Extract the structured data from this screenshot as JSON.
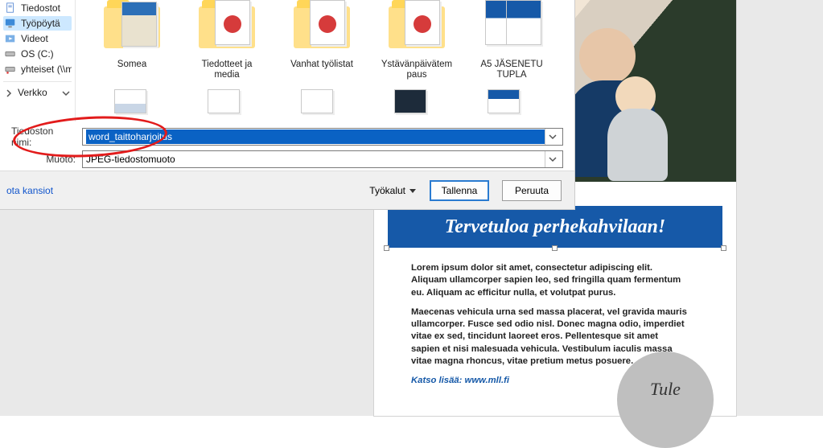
{
  "sidebar": {
    "items": [
      {
        "label": "Tiedostot",
        "icon": "document-icon"
      },
      {
        "label": "Työpöytä",
        "icon": "desktop-icon"
      },
      {
        "label": "Videot",
        "icon": "video-icon"
      },
      {
        "label": "OS (C:)",
        "icon": "drive-icon"
      },
      {
        "label": "yhteiset (\\\\mlltku",
        "icon": "network-drive-icon"
      }
    ],
    "network_label": "Verkko"
  },
  "files": {
    "row1": [
      {
        "label": "Somea",
        "kind": "folder"
      },
      {
        "label": "Tiedotteet ja media",
        "kind": "folder-pdf"
      },
      {
        "label": "Vanhat työlistat",
        "kind": "folder-pdf"
      },
      {
        "label": "Ystävänpäivätem paus",
        "kind": "folder-pdf"
      },
      {
        "label": "A5 JÄSENETU TUPLA",
        "kind": "doc-blue"
      }
    ]
  },
  "fields": {
    "filename_label": "Tiedoston nimi:",
    "filename_value": "word_taittoharjoitus",
    "format_label": "Muoto:",
    "format_value": "JPEG-tiedostomuoto"
  },
  "footer": {
    "hide_folders": "ota kansiot",
    "tools_label": "Työkalut",
    "save_label": "Tallenna",
    "cancel_label": "Peruuta"
  },
  "document": {
    "banner": "Tervetuloa perhekahvilaan!",
    "para1": "Lorem ipsum dolor sit amet, consectetur adipiscing elit. Aliquam ullamcorper sapien leo, sed fringilla quam fermentum eu. Aliquam ac efficitur nulla, et volutpat purus.",
    "para2": "Maecenas vehicula urna sed massa placerat, vel gravida mauris ullamcorper. Fusce sed odio nisl. Donec magna odio, imperdiet vitae ex sed, tincidunt laoreet eros. Pellentesque sit amet sapien et nisi malesuada vehicula. Vestibulum iaculis massa vitae magna rhoncus, vitae pretium metus posuere.",
    "link_text": "Katso lisää: www.mll.fi",
    "badge_text": "Tule"
  }
}
